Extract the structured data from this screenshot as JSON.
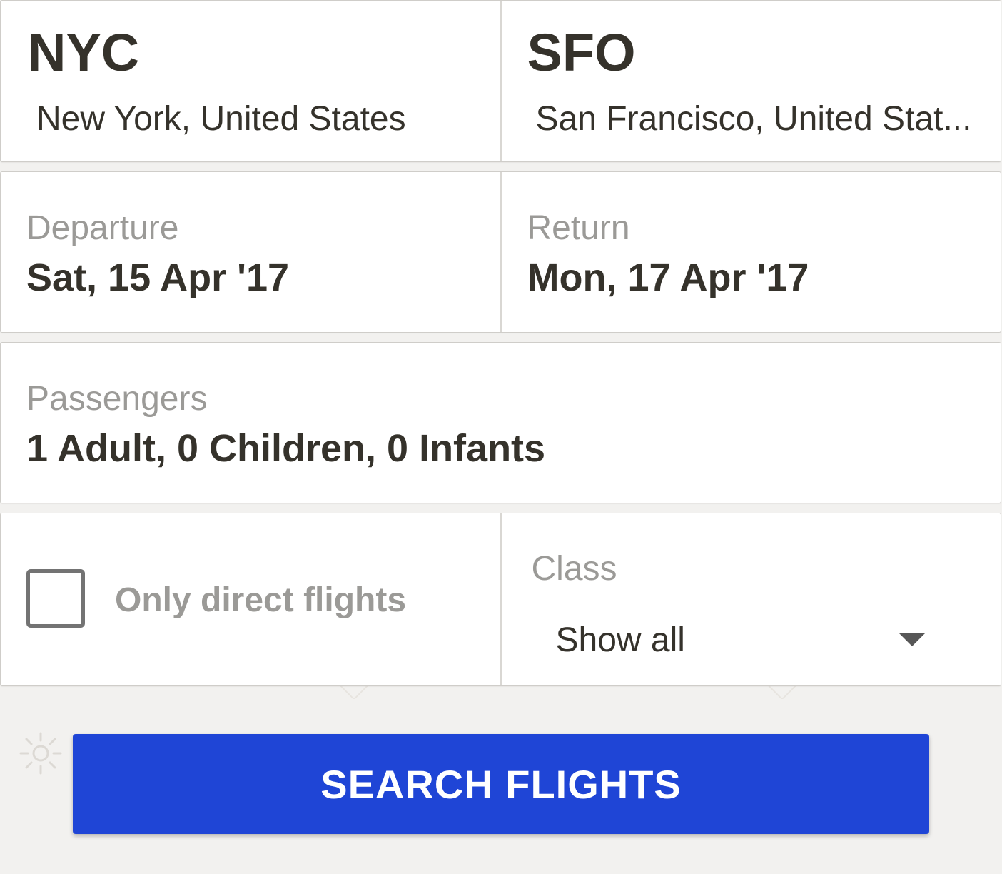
{
  "origin": {
    "code": "NYC",
    "city": "New York, United States"
  },
  "destination": {
    "code": "SFO",
    "city": "San Francisco, United Stat..."
  },
  "departure": {
    "label": "Departure",
    "value": "Sat, 15 Apr '17"
  },
  "return_date": {
    "label": "Return",
    "value": "Mon, 17 Apr '17"
  },
  "passengers": {
    "label": "Passengers",
    "value": "1 Adult, 0 Children, 0 Infants"
  },
  "direct_flights": {
    "label": "Only direct flights",
    "checked": false
  },
  "travel_class": {
    "label": "Class",
    "selected": "Show all"
  },
  "search_button": {
    "label": "SEARCH FLIGHTS"
  },
  "colors": {
    "accent": "#1f45d6",
    "background": "#f2f1ef",
    "text_primary": "#35322b",
    "text_muted": "#9b9a97"
  },
  "icons": {
    "decorative": "sun-icon",
    "select": "caret-down-icon"
  }
}
